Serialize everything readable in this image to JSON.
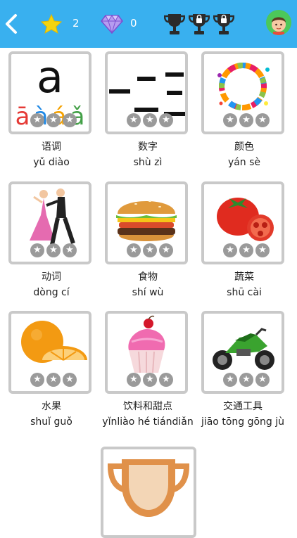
{
  "header": {
    "star_count": "2",
    "gem_count": "0",
    "colors": {
      "bar": "#39b0ef",
      "star": "#f5d40f",
      "gem": "#8a5cd6"
    }
  },
  "categories": [
    {
      "zh": "语调",
      "py": "yǔ diào",
      "art_letter": "a",
      "art_tones": [
        "ā",
        "à",
        "á",
        "ǎ"
      ],
      "icon": "pinyin-tones-icon"
    },
    {
      "zh": "数字",
      "py": "shù zì",
      "icon": "chinese-numerals-icon"
    },
    {
      "zh": "颜色",
      "py": "yán sè",
      "icon": "paint-splash-icon"
    },
    {
      "zh": "动词",
      "py": "dòng cí",
      "icon": "dancing-couple-icon"
    },
    {
      "zh": "食物",
      "py": "shí wù",
      "icon": "burger-icon"
    },
    {
      "zh": "蔬菜",
      "py": "shū cài",
      "icon": "tomato-icon"
    },
    {
      "zh": "水果",
      "py": "shuǐ guǒ",
      "icon": "orange-icon"
    },
    {
      "zh": "饮料和甜点",
      "py": "yǐnliào hé tiándiǎn",
      "icon": "cupcake-icon"
    },
    {
      "zh": "交通工具",
      "py": "jiāo tōng gōng jù",
      "icon": "motorcycle-icon"
    }
  ],
  "star_glyph": "★"
}
